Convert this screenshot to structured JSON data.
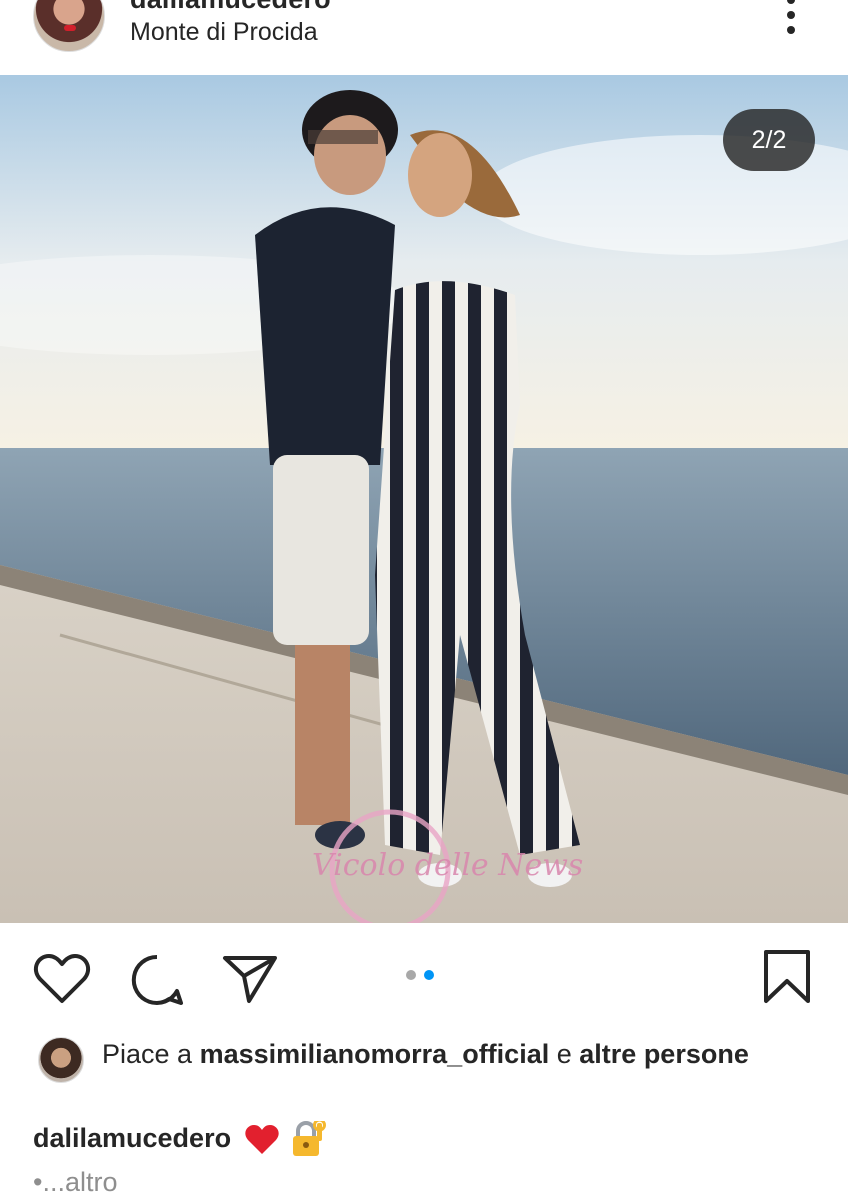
{
  "header": {
    "username": "dalilamucedero",
    "location": "Monte di Procida"
  },
  "photo": {
    "counter": "2/2",
    "watermark": "Vicolo delle News"
  },
  "carousel": {
    "current": 2,
    "total": 2
  },
  "likes": {
    "prefix": "Piace a",
    "liker": "massimilianomorra_official",
    "connector": "e",
    "others": "altre persone"
  },
  "caption": {
    "username": "dalilamucedero",
    "emojis": [
      "red-heart-emoji",
      "locked-with-key-emoji"
    ]
  },
  "more_link": "•...altro",
  "colors": {
    "accent": "#0095f6",
    "text": "#262626",
    "muted": "#8e8e8e"
  }
}
